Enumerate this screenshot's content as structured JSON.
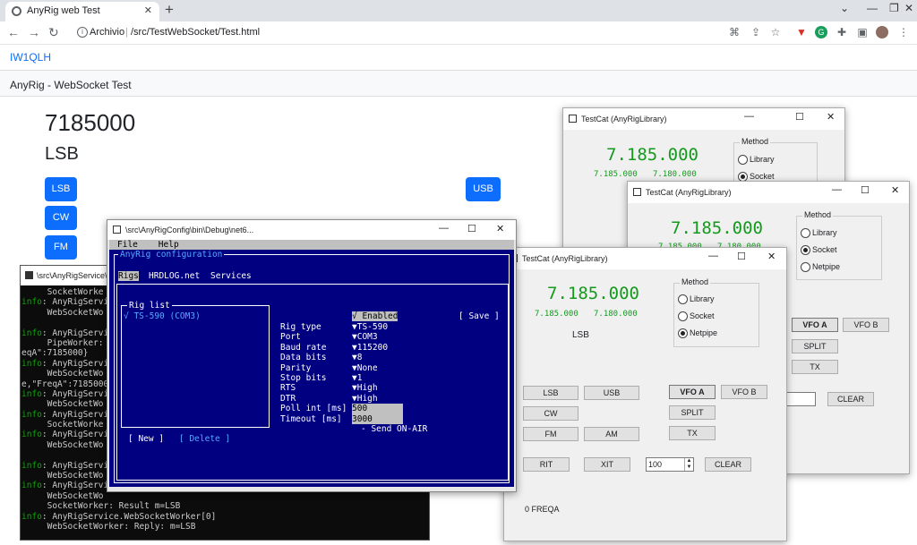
{
  "browser": {
    "tab_title": "AnyRig web Test",
    "address_label": "Archivio",
    "address_path": "/src/TestWebSocket/Test.html",
    "new_tab": "+",
    "close": "✕"
  },
  "page": {
    "brand": "IW1QLH",
    "navbar_title": "AnyRig - WebSocket Test",
    "frequency": "7185000",
    "mode": "LSB",
    "buttons": {
      "lsb": "LSB",
      "usb": "USB",
      "cw": "CW",
      "fm": "FM"
    }
  },
  "testcat_back": {
    "title": "TestCat (AnyRigLibrary)",
    "freq_main": "7.185.000",
    "freq_a": "7.185.000",
    "freq_b": "7.180.000",
    "method_label": "Method",
    "methods": [
      "Library",
      "Socket"
    ],
    "selected": "Socket"
  },
  "testcat_mid": {
    "title": "TestCat (AnyRigLibrary)",
    "freq_main": "7.185.000",
    "freq_a": "7.185.000",
    "freq_b": "7.180.000",
    "method_label": "Method",
    "methods": [
      "Library",
      "Socket",
      "Netpipe"
    ],
    "selected": "Socket",
    "vfo_a": "VFO A",
    "vfo_b": "VFO B",
    "split": "SPLIT",
    "tx": "TX",
    "clear": "CLEAR"
  },
  "testcat_front": {
    "title": "TestCat (AnyRigLibrary)",
    "freq_main": "7.185.000",
    "freq_a": "7.185.000",
    "freq_b": "7.180.000",
    "mode": "LSB",
    "method_label": "Method",
    "methods": [
      "Library",
      "Socket",
      "Netpipe"
    ],
    "selected": "Netpipe",
    "buttons": {
      "lsb": "LSB",
      "usb": "USB",
      "cw": "CW",
      "fm": "FM",
      "am": "AM",
      "rit": "RIT",
      "xit": "XIT",
      "vfo_a": "VFO A",
      "vfo_b": "VFO B",
      "split": "SPLIT",
      "tx": "TX",
      "clear": "CLEAR"
    },
    "spin_value": "100",
    "status": "0 FREQA"
  },
  "console": {
    "title": "\\src\\AnyRigService\\b",
    "lines": [
      [
        "",
        "     SocketWorke"
      ],
      [
        "info",
        ": AnyRigServi"
      ],
      [
        "",
        "     WebSocketWo"
      ],
      [
        "",
        ""
      ],
      [
        "info",
        ": AnyRigServi"
      ],
      [
        "",
        "     PipeWorker:"
      ],
      [
        "",
        "eqA\":7185000}"
      ],
      [
        "info",
        ": AnyRigServi"
      ],
      [
        "",
        "     WebSocketWo"
      ],
      [
        "",
        "e,\"FreqA\":7185000"
      ],
      [
        "info",
        ": AnyRigServi"
      ],
      [
        "",
        "     WebSocketWo"
      ],
      [
        "info",
        ": AnyRigServi"
      ],
      [
        "",
        "     SocketWorke"
      ],
      [
        "info",
        ": AnyRigServi"
      ],
      [
        "",
        "     WebSocketWo"
      ],
      [
        "",
        ""
      ],
      [
        "info",
        ": AnyRigServi"
      ],
      [
        "",
        "     WebSocketWo"
      ],
      [
        "info",
        ": AnyRigServi"
      ],
      [
        "",
        "     WebSocketWo"
      ],
      [
        "",
        "     SocketWorker: Result m=LSB"
      ],
      [
        "info",
        ": AnyRigService.WebSocketWorker[0]"
      ],
      [
        "",
        "     WebSocketWorker: Reply: m=LSB"
      ]
    ]
  },
  "config": {
    "title": "\\src\\AnyRigConfig\\bin\\Debug\\net6...",
    "menu": [
      "File",
      "Help"
    ],
    "dialog_title": "AnyRig configuration",
    "tabs": [
      "Rigs",
      "HRDLOG.net",
      "Services"
    ],
    "rig_list_label": "Rig list",
    "rig_item": "√ TS-590 (COM3)",
    "enabled": "√ Enabled",
    "save": "[ Save ]",
    "fields": [
      {
        "label": "Rig type",
        "value": "▼TS-590"
      },
      {
        "label": "Port",
        "value": "▼COM3"
      },
      {
        "label": "Baud rate",
        "value": "▼115200"
      },
      {
        "label": "Data bits",
        "value": "▼8"
      },
      {
        "label": "Parity",
        "value": "▼None"
      },
      {
        "label": "Stop bits",
        "value": "▼1"
      },
      {
        "label": "RTS",
        "value": "▼High"
      },
      {
        "label": "DTR",
        "value": "▼High"
      },
      {
        "label": "Poll int [ms]",
        "value": "500"
      },
      {
        "label": "Timeout [ms]",
        "value": "3000"
      }
    ],
    "send": "- Send ON-AIR",
    "new": "[ New ]",
    "delete": "[ Delete ]"
  },
  "colors": {
    "accent": "#0d6efd",
    "lcd": "#139a1d",
    "tui_bg": "#000080"
  }
}
